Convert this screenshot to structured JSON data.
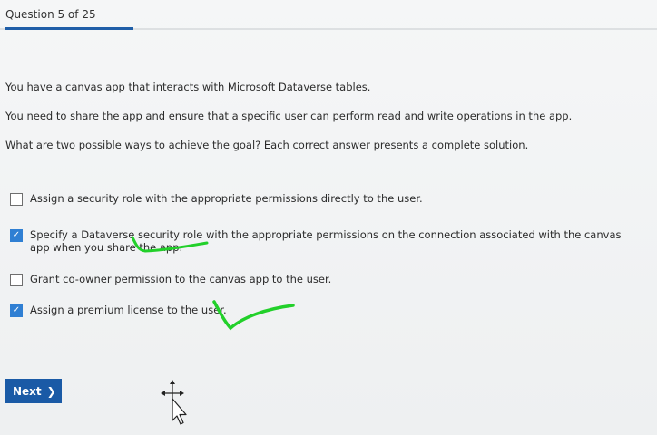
{
  "header": {
    "question_counter": "Question 5 of 25",
    "progress": 0.2
  },
  "question": {
    "stem_lines": [
      "You have a canvas app that interacts with Microsoft Dataverse tables.",
      "You need to share the app and ensure that a specific user can perform read and write operations in the app.",
      "What are two possible ways to achieve the goal? Each correct answer presents a complete solution."
    ],
    "options": [
      {
        "label": "Assign a security role with the appropriate permissions directly to the user.",
        "checked": false
      },
      {
        "label": "Specify a Dataverse security role with the appropriate permissions on the connection associated with the canvas app when you share the app.",
        "checked": true
      },
      {
        "label": "Grant co-owner permission to the canvas app to the user.",
        "checked": false
      },
      {
        "label": "Assign a premium license to the user.",
        "checked": true
      }
    ]
  },
  "footer": {
    "next_label": "Next"
  },
  "colors": {
    "accent": "#1f5ea8",
    "checkbox_checked": "#2f7fd3",
    "annotation": "#22d02a"
  },
  "icons": {
    "next": "chevron-right-icon",
    "check": "checkmark-icon",
    "cursor": "move-cursor-icon"
  }
}
